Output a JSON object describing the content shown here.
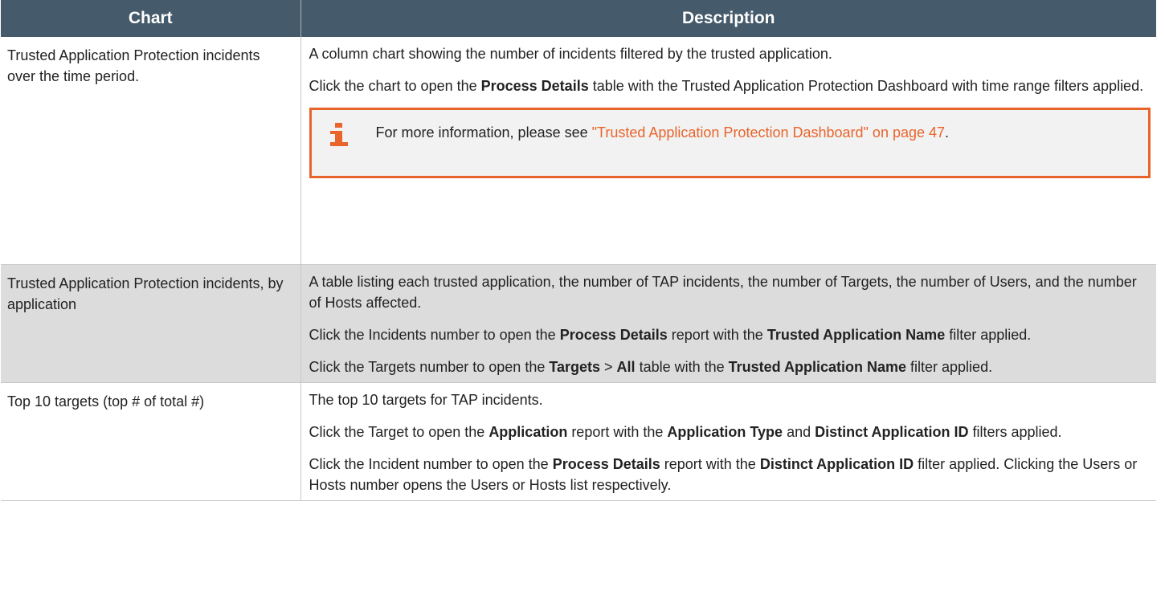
{
  "header": {
    "col_chart": "Chart",
    "col_description": "Description"
  },
  "rows": [
    {
      "chart": "Trusted Application Protection incidents over the time period.",
      "desc": [
        {
          "text": "A column chart showing the number of incidents filtered by the trusted application."
        },
        {
          "pre": "Click the chart to open the ",
          "b1": "Process Details",
          "post": " table with the Trusted Application Protection Dashboard with time range filters applied."
        }
      ],
      "note": {
        "icon": "info-icon",
        "pre": "For more information, please see ",
        "link": "\"Trusted Application Protection Dashboard\" on page 47",
        "post": "."
      }
    },
    {
      "chart": "Trusted Application Protection incidents, by application",
      "desc": [
        {
          "text": "A table listing each trusted application, the number of TAP incidents, the number of Targets, the number of Users, and the number of Hosts affected."
        },
        {
          "pre": "Click the Incidents number to open the ",
          "b1": "Process Details",
          "mid": " report with the ",
          "b2": "Trusted Application Name",
          "post": " filter applied."
        },
        {
          "pre": "Click the Targets number to open the ",
          "b1": "Targets",
          "sep": " > ",
          "b1b": "All",
          "mid": " table with the ",
          "b2": "Trusted Application Name",
          "post": " filter applied."
        }
      ]
    },
    {
      "chart": "Top 10 targets (top # of total #)",
      "desc": [
        {
          "text": "The top 10 targets for TAP incidents."
        },
        {
          "pre": "Click the Target to open the ",
          "b1": "Application",
          "mid": " report with the ",
          "b2": "Application Type",
          "mid2": " and ",
          "b3": "Distinct Application ID",
          "post": " filters applied."
        },
        {
          "pre": "Click the Incident number to open the ",
          "b1": "Process Details",
          "mid": " report with the ",
          "b2": "Distinct Application ID",
          "post": " filter applied. Clicking the Users or Hosts number opens the Users or Hosts list respectively."
        }
      ]
    }
  ],
  "colors": {
    "header_bg": "#455a6a",
    "alt_row_bg": "#dcdcdc",
    "accent": "#e8642b"
  }
}
